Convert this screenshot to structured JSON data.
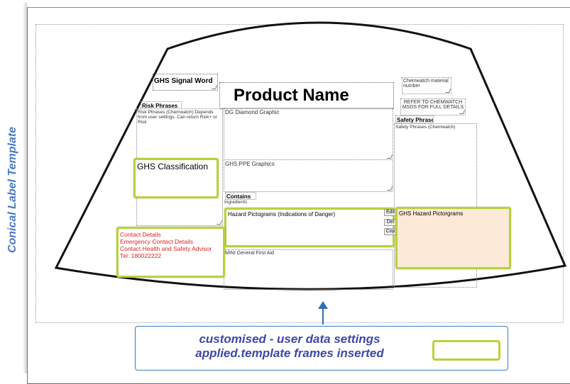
{
  "sidebar": {
    "title": "Conical Label Template"
  },
  "frames": {
    "signal_word": "GHS Signal Word",
    "product_name": "Product Name",
    "chemwatch_material": "Chemwatch material number",
    "refer_msds": "REFER TO CHEMWATCH MSDS FOR FULL DETAILS",
    "risk_phrases_title": "Risk Phrases",
    "risk_phrases_body": "Risk Phrases (Chemwatch) Depends from user settings. Can return Risk+ or Risk",
    "dg_diamond": "DG Diamond Graphic",
    "safety_phrases_title": "Safety Phrases",
    "safety_phrases_body": "Safety Phrases (Chemwatch)",
    "ghs_classification": "GHS Classification",
    "ghs_ppe": "GHS PPE Graphics",
    "contains": "Contains",
    "ingredients": "Ingredients",
    "hazard_pictograms": "Hazard Pictograms (Indications of Danger)",
    "ghs_hazard_pictograms": "GHS Hazard Pictorgrams",
    "contact_lines": [
      "Contact Details",
      "Emergency Contact Details",
      "Contact Health and Safety Advisor",
      "Tel: 180022222"
    ],
    "first_aid": "MINI General First Aid"
  },
  "buttons": {
    "edit": "Edit",
    "delete": "Del",
    "copy": "Cop"
  },
  "callout": {
    "line1": "customised - user data settings",
    "line2": "applied.template frames inserted"
  },
  "colors": {
    "highlight": "#b7d23b",
    "contact_text": "#e02020",
    "callout_text": "#3c47a8",
    "sidebar_text": "#4a78c2",
    "ghs_hazard_fill": "#fce9d8"
  }
}
